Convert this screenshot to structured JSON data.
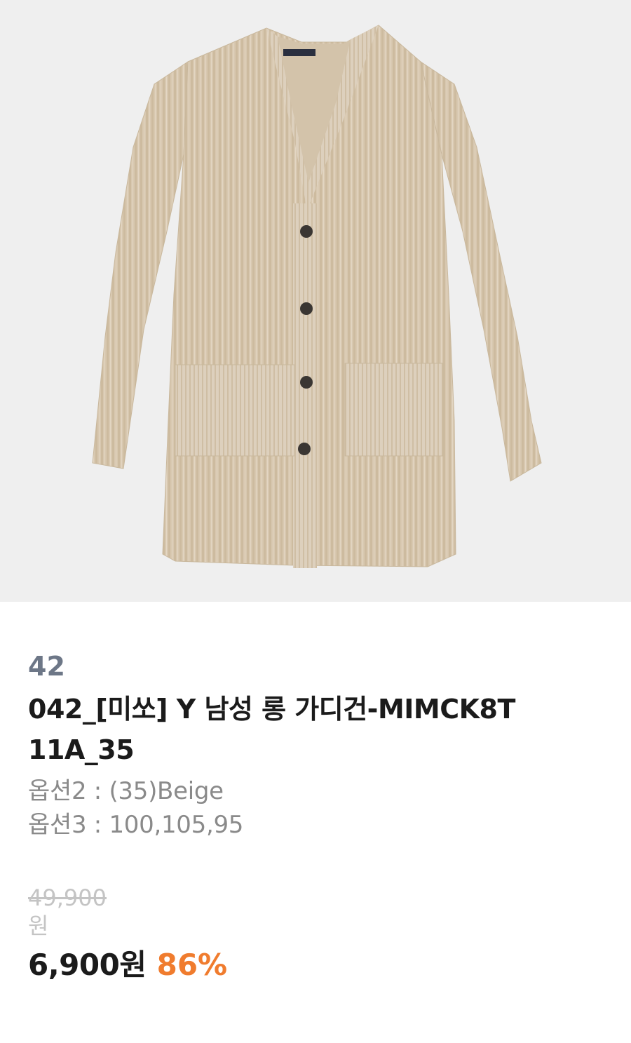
{
  "product": {
    "number": "42",
    "title_line1": "042_[미쏘] Y 남성 롱 가디건-MIMCK8T",
    "title_line2": "11A_35",
    "options": [
      {
        "text": "옵션2 : (35)Beige"
      },
      {
        "text": "옵션3 : 100,105,95"
      }
    ],
    "original_price": "49,900",
    "original_price_unit": "원",
    "sale_price": "6,900원",
    "discount": "86%"
  },
  "colors": {
    "image_background": "#efefef",
    "cardigan": "#d9c9b2",
    "number_gray": "#6d7787",
    "title_dark": "#1b1b1b",
    "option_gray": "#8a8a8a",
    "discount_orange": "#f07c2e"
  },
  "image": {
    "subject": "cardigan-illustration"
  }
}
